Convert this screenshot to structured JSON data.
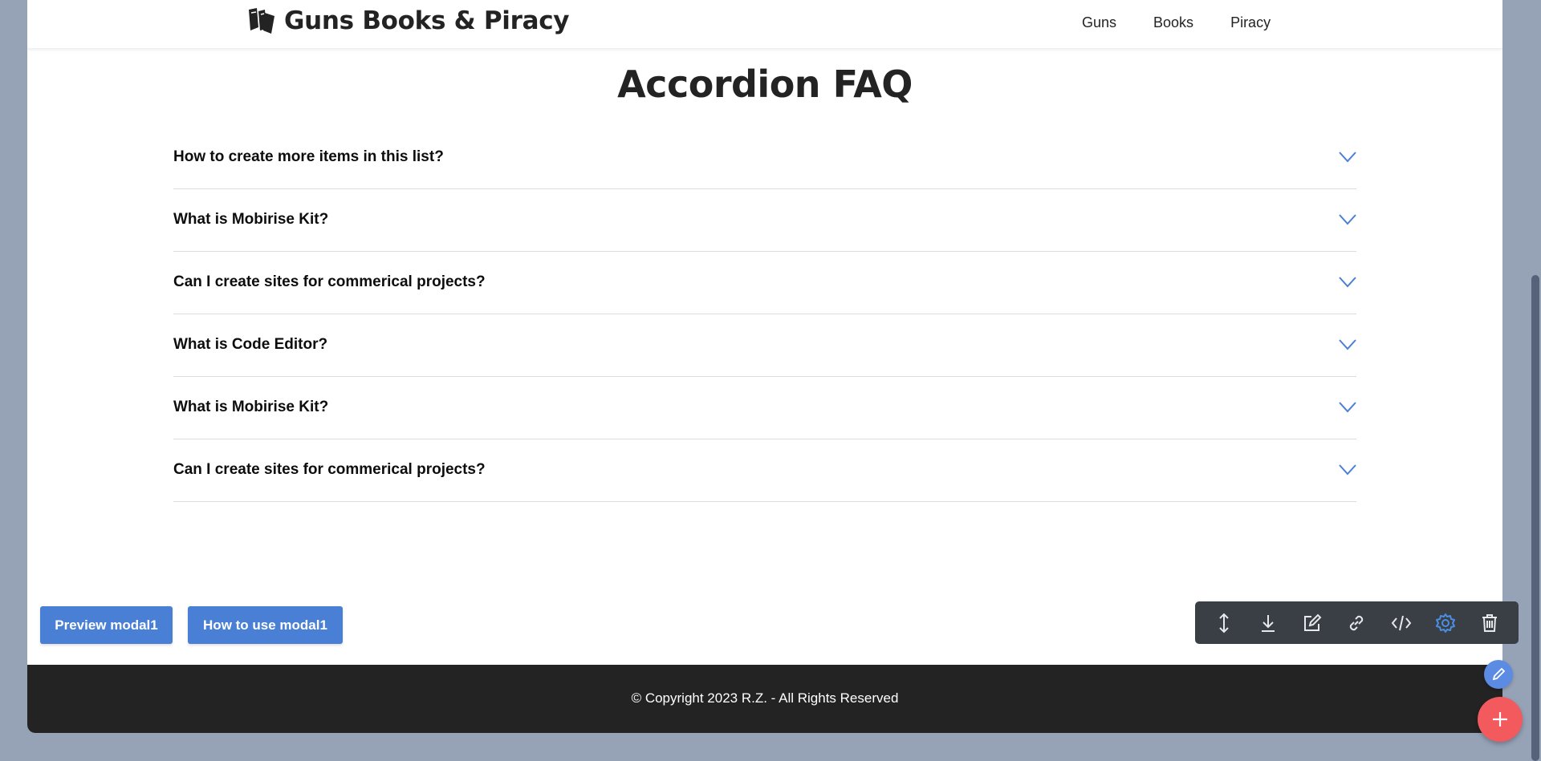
{
  "header": {
    "brand_title": "Guns Books & Piracy",
    "brand_icon": "books-icon",
    "nav": [
      {
        "label": "Guns"
      },
      {
        "label": "Books"
      },
      {
        "label": "Piracy"
      }
    ]
  },
  "main": {
    "title": "Accordion FAQ",
    "faq_items": [
      {
        "question": "How to create more items in this list?"
      },
      {
        "question": "What is Mobirise Kit?"
      },
      {
        "question": "Can I create sites for commerical projects?"
      },
      {
        "question": "What is Code Editor?"
      },
      {
        "question": "What is Mobirise Kit?"
      },
      {
        "question": "Can I create sites for commerical projects?"
      }
    ]
  },
  "buttons": {
    "preview_label": "Preview modal1",
    "howto_label": "How to use modal1"
  },
  "footer": {
    "copyright": "© Copyright 2023 R.Z. - All Rights Reserved"
  },
  "toolbar": {
    "tools": [
      "move-icon",
      "download-icon",
      "edit-icon",
      "link-icon",
      "code-icon",
      "gear-icon",
      "trash-icon"
    ]
  },
  "colors": {
    "accent": "#4a7fd6",
    "chevron": "#4a7fd6",
    "footer_bg": "#232323",
    "toolbar_bg": "#3a3e45",
    "fab_add": "#f25a5e",
    "fab_edit": "#5b8be3",
    "backdrop": "#96a2b6"
  }
}
